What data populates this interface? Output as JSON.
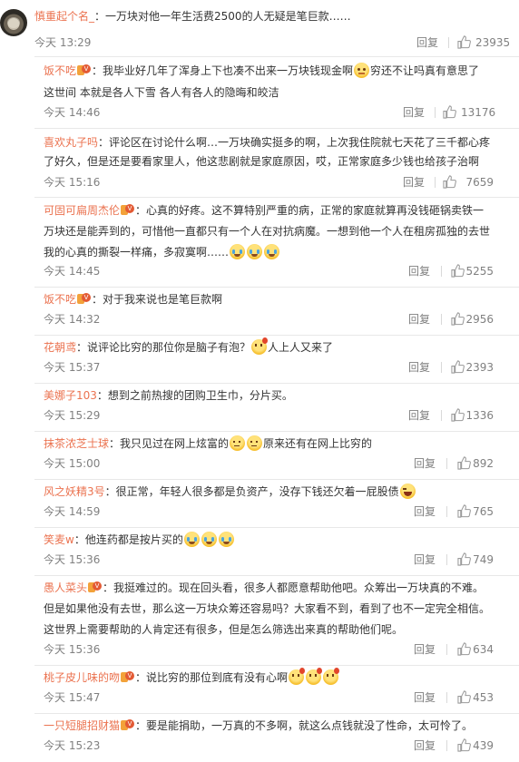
{
  "like_icon": "thumbs-up-icon",
  "reply_label": "回复",
  "colors": {
    "username": "#eb7350",
    "meta": "#808080",
    "text": "#333333"
  },
  "top_comment": {
    "user": "慎重起个名_",
    "text": "一万块对他一年生活费2500的人无疑是笔巨款……",
    "time": "今天 13:29",
    "likes": "23935"
  },
  "replies": [
    {
      "user": "饭不吃",
      "lines": [
        "我毕业好几年了浑身上下也凑不出来一万块钱现金啊",
        "穷还不让吗真有意思了",
        "这世间 本就是各人下雪 各人有各人的隐晦和皎洁"
      ],
      "time": "今天 14:46",
      "likes": "13176"
    },
    {
      "user": "喜欢丸子吗",
      "lines": [
        "评论区在讨论什么啊…一万块确实挺多的啊，上次我住院就七天花了三千都心疼",
        "了好久，但是还是要看家里人，他这悲剧就是家庭原因，哎，正常家庭多少钱也给孩子治啊"
      ],
      "time": "今天 15:16",
      "likes": "7659"
    },
    {
      "user": "可固可扁周杰伦",
      "lines": [
        "心真的好疼。这不算特别严重的病，正常的家庭就算再没钱砸锅卖铁一",
        "万块还是能弄到的，可惜他一直都只有一个人在对抗病魔。一想到他一个人在租房孤独的去世",
        "我的心真的撕裂一样痛，多寂寞啊……"
      ],
      "time": "今天 14:45",
      "likes": "5255"
    },
    {
      "user": "饭不吃",
      "lines": [
        "对于我来说也是笔巨款啊"
      ],
      "time": "今天 14:32",
      "likes": "2956"
    },
    {
      "user": "花朝鸢",
      "lines": [
        "说评论比穷的那位你是脑子有泡？",
        "人上人又来了"
      ],
      "time": "今天 15:37",
      "likes": "2393"
    },
    {
      "user": "美娜子103",
      "lines": [
        "想到之前热搜的团购卫生巾，分片买。"
      ],
      "time": "今天 15:29",
      "likes": "1336"
    },
    {
      "user": "抹茶浓芝士球",
      "lines": [
        "我只见过在网上炫富的",
        "原来还有在网上比穷的"
      ],
      "time": "今天 15:00",
      "likes": "892"
    },
    {
      "user": "风之妖精3号",
      "lines": [
        "很正常，年轻人很多都是负资产，没存下钱还欠着一屁股债"
      ],
      "time": "今天 14:59",
      "likes": "765"
    },
    {
      "user": "笑麦w",
      "lines": [
        "他连药都是按片买的"
      ],
      "time": "今天 15:36",
      "likes": "749"
    },
    {
      "user": "愚人菜头",
      "lines": [
        "我挺难过的。现在回头看，很多人都愿意帮助他吧。众筹出一万块真的不难。",
        "但是如果他没有去世，那么这一万块众筹还容易吗？大家看不到，看到了也不一定完全相信。",
        "这世界上需要帮助的人肯定还有很多，但是怎么筛选出来真的帮助他们呢。"
      ],
      "time": "今天 15:36",
      "likes": "634"
    },
    {
      "user": "桃子皮儿味的吻",
      "lines": [
        "说比穷的那位到底有没有心啊"
      ],
      "time": "今天 15:47",
      "likes": "453"
    },
    {
      "user": "一只短腿招财猫",
      "lines": [
        "要是能捐助，一万真的不多啊，就这么点钱就没了性命，太可怜了。"
      ],
      "time": "今天 15:23",
      "likes": "439"
    }
  ]
}
